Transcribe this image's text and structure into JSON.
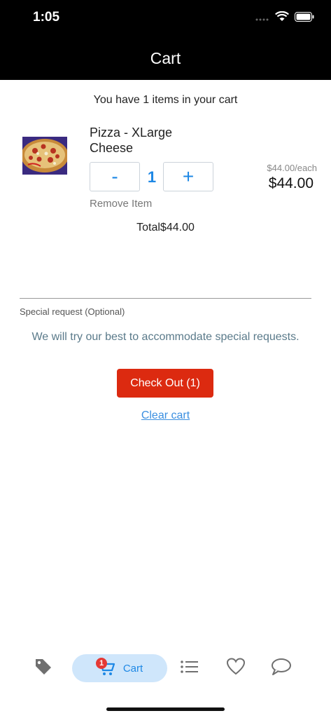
{
  "status_bar": {
    "time": "1:05"
  },
  "nav": {
    "title": "Cart"
  },
  "cart": {
    "summary": "You have 1 items in your cart",
    "items": [
      {
        "name_line1": "Pizza - XLarge",
        "name_line2": "Cheese",
        "quantity": "1",
        "minus_label": "-",
        "plus_label": "+",
        "remove_label": "Remove Item",
        "unit_price": "$44.00/each",
        "line_price": "$44.00"
      }
    ],
    "total": "Total$44.00"
  },
  "special_request": {
    "label": "Special request (Optional)",
    "hint": "We will try our best to accommodate special requests."
  },
  "actions": {
    "checkout_label": "Check Out (1)",
    "clear_label": "Clear cart"
  },
  "tabbar": {
    "active_label": "Cart",
    "cart_badge": "1",
    "tabs": [
      {
        "name": "tag-icon"
      },
      {
        "name": "cart-icon",
        "label": "Cart"
      },
      {
        "name": "list-icon"
      },
      {
        "name": "heart-icon"
      },
      {
        "name": "chat-icon"
      }
    ]
  },
  "colors": {
    "accent": "#1e88e5",
    "checkout": "#dc2a10",
    "active_tab_bg": "#cfe6fb",
    "badge": "#e53935"
  }
}
